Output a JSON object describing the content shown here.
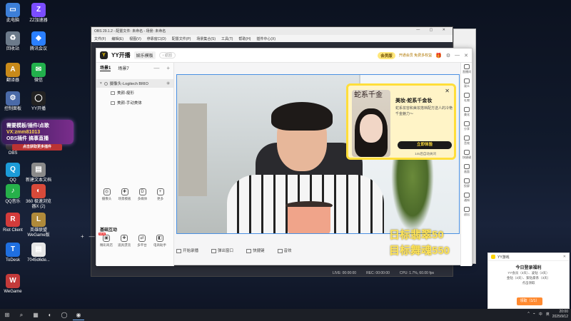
{
  "desktop": {
    "icons": [
      {
        "label": "此电脑",
        "glyph": "▭",
        "color": "#3d7fd8"
      },
      {
        "label": "ZZ加速器",
        "glyph": "Z",
        "color": "#7b4dff"
      },
      {
        "label": "回收站",
        "glyph": "♻",
        "color": "#6c7a8a"
      },
      {
        "label": "腾讯会议",
        "glyph": "◆",
        "color": "#2a7fff"
      },
      {
        "label": "翻译器",
        "glyph": "A",
        "color": "#c88a1a"
      },
      {
        "label": "微信",
        "glyph": "✉",
        "color": "#22b14c"
      },
      {
        "label": "控制面板",
        "glyph": "⚙",
        "color": "#4a6aa8"
      },
      {
        "label": "YY开播",
        "glyph": "◯",
        "color": "#222222"
      },
      {
        "label": "OBS",
        "glyph": "●",
        "color": "#333333"
      },
      {
        "label": "QQ",
        "glyph": "Q",
        "color": "#1c9bd8"
      },
      {
        "label": "新建文本文档",
        "glyph": "▤",
        "color": "#8a8a8a"
      },
      {
        "label": "QQ音乐",
        "glyph": "♪",
        "color": "#26b04a"
      },
      {
        "label": "360 极速浏览器X (2)",
        "glyph": "◐",
        "color": "#d84a3a"
      },
      {
        "label": "Riot Client",
        "glyph": "R",
        "color": "#d33b3b"
      },
      {
        "label": "英雄联盟 WeGame版",
        "glyph": "L",
        "color": "#b08a3a"
      },
      {
        "label": "ToDesk",
        "glyph": "T",
        "color": "#1f6fe0"
      },
      {
        "label": "7045d6de...",
        "glyph": "▤",
        "color": "#e6e6e6"
      },
      {
        "label": "WeGame",
        "glyph": "W",
        "color": "#c33a3a"
      }
    ],
    "promo": {
      "line1": "需要模板/插件/点歌",
      "line2": "VX:zmm81013",
      "line3": "OBS插件 搞事直播",
      "tag": "点击获取更多插件"
    }
  },
  "obs": {
    "title": "OBS 29.1.2 - 配置文件: 未命名 - 场景: 未命名",
    "menu": [
      "文件(F)",
      "编辑(E)",
      "视图(V)",
      "停靠窗口(D)",
      "配置文件(P)",
      "场景集合(S)",
      "工具(T)",
      "帮助(H)",
      "插件中心(X)"
    ],
    "window_controls": "— ▢ ✕",
    "tools": [
      "+",
      "—",
      "⚙",
      "^",
      "v"
    ],
    "status": {
      "live": "LIVE: 00:00:00",
      "rec": "REC: 00:00:00",
      "cpu": "CPU: 1.7%, 60.00 fps"
    }
  },
  "yy": {
    "logo_glyph": "Y",
    "brand": "YY开播",
    "mode": "娱乐模板",
    "back": "‹ 返回",
    "vip": "会员版",
    "vip_note": "开通会员 免费多权益",
    "header_icons": [
      "🎁",
      "⚙",
      "—",
      "✕"
    ],
    "scene_tabs": [
      "场景1",
      "场景7"
    ],
    "scene_add": "+",
    "scene_minus": "—",
    "sources": {
      "main": "摄像头-Logitech BRIO",
      "children": [
        "美颜-瘦形",
        "美颜-手动美体"
      ]
    },
    "tools": [
      {
        "label": "摄像头",
        "glyph": "◎"
      },
      {
        "label": "场景模板",
        "glyph": "✚"
      },
      {
        "label": "多媒体",
        "glyph": "D"
      },
      {
        "label": "更多",
        "glyph": "+"
      }
    ],
    "interact_title": "基础互动",
    "interacts": [
      {
        "label": "精彩商店",
        "glyph": "▣",
        "new": "NEW"
      },
      {
        "label": "道具漂流",
        "glyph": "✚"
      },
      {
        "label": "多平台",
        "glyph": "⇄"
      },
      {
        "label": "电商助手",
        "glyph": "◧"
      }
    ],
    "controls": [
      "开始录播",
      "弹出窗口",
      "快捷键",
      "音效"
    ],
    "goal_line1": "日标翡翠50",
    "goal_line2": "目标舞魂550",
    "right_bar": [
      "直播间",
      "观众",
      "礼物",
      "美化",
      "分享",
      "音效",
      "快捷键",
      "画面",
      "投屏",
      "通知",
      "退出"
    ]
  },
  "beauty_popup": {
    "title": "美妆-蛇系千金妆",
    "desc": "蛇系妆容和美妆搭档配方送人的冷艳千金魅力～",
    "button": "立即体验",
    "note": "14s后自动关闭",
    "close": "✕",
    "image_text": "蛇系千金"
  },
  "notification": {
    "app": "YY游戏",
    "close": "✕",
    "title": "今日登录福利",
    "lines": [
      "YY会员（3天）、凌钻（3天）",
      "金钻（3天）、紫钻豪系（3天）",
      "点击领取"
    ],
    "button": "领取（1/1）"
  },
  "taskbar": {
    "icons": [
      "⊞",
      "⌕",
      "▦",
      "◐",
      "◯",
      "◉"
    ],
    "tray": [
      "^",
      "⌁",
      "中",
      "英"
    ],
    "time": "20:00",
    "date": "2025/9/12"
  }
}
